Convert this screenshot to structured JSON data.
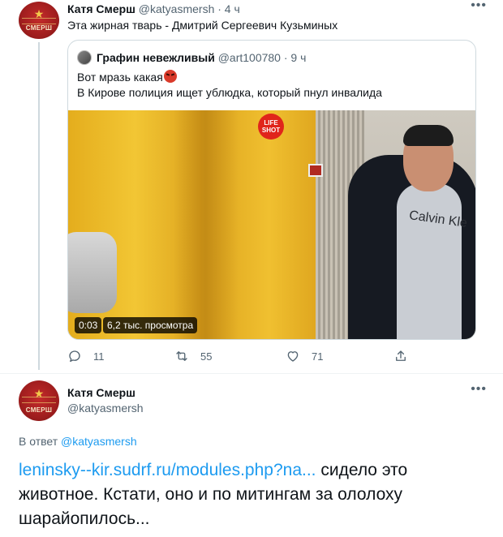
{
  "tweet1": {
    "author": "Катя Смерш",
    "handle": "@katyasmersh",
    "time": "· 4 ч",
    "text": "Эта жирная тварь - Дмитрий Сергеевич Кузьминых",
    "avatar_text": "СМЕРШ",
    "quoted": {
      "author": "Графин невежливый",
      "handle": "@art100780",
      "time": "· 9 ч",
      "line1": "Вот мразь какая",
      "line2": "В Кирове полиция ищет ублюдка, который пнул инвалида",
      "video": {
        "logo_line1": "LIFE",
        "logo_line2": "SHOT",
        "duration": "0:03",
        "views": "6,2 тыс. просмотра",
        "shirt_text": "Calvin Kle"
      }
    },
    "actions": {
      "replies": "11",
      "retweets": "55",
      "likes": "71"
    }
  },
  "tweet2": {
    "author": "Катя Смерш",
    "handle": "@katyasmersh",
    "avatar_text": "СМЕРШ",
    "reply_prefix": "В ответ",
    "reply_to": "@katyasmersh",
    "link": "leninsky--kir.sudrf.ru/modules.php?na...",
    "text": " сидело это животное. Кстати, оно и по митингам за ололоху шарайопилось..."
  },
  "icons": {
    "more": "more-icon",
    "reply": "reply-icon",
    "retweet": "retweet-icon",
    "like": "heart-icon",
    "share": "share-icon",
    "angry_emoji": "angry-face-icon"
  },
  "colors": {
    "link": "#1d9bf0",
    "muted": "#536471",
    "border": "#cfd9de"
  }
}
